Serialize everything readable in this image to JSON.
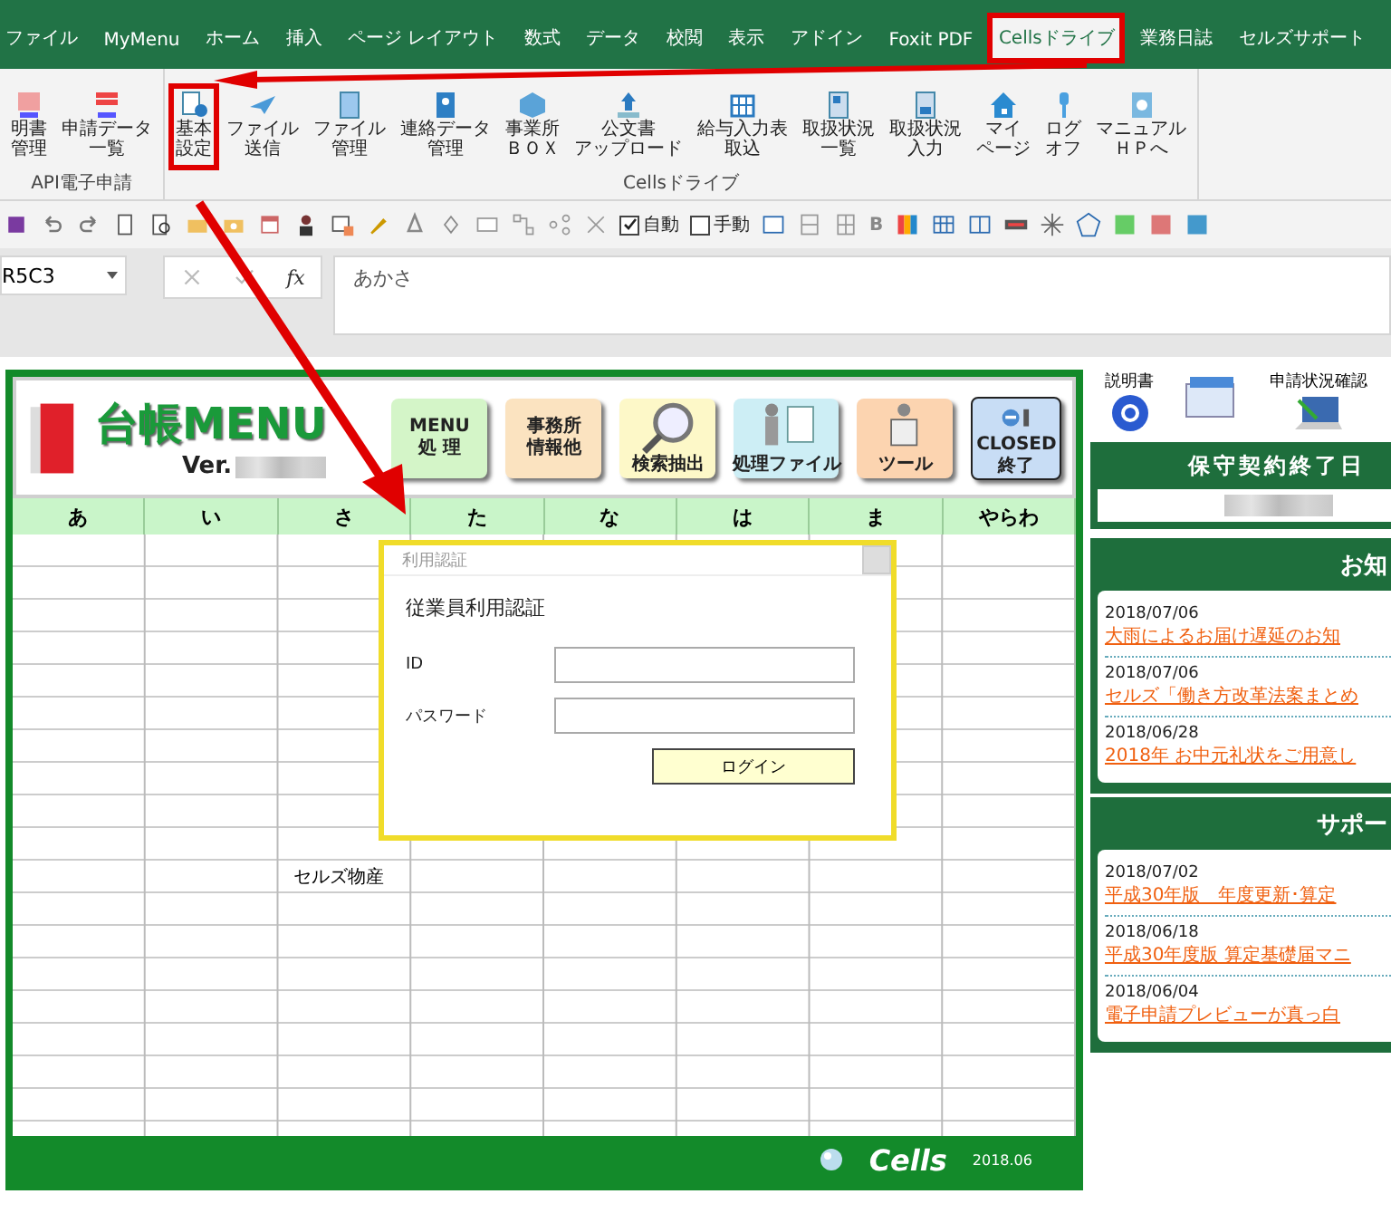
{
  "ribbon_tabs": [
    {
      "label": "ファイル",
      "selected": false
    },
    {
      "label": "MyMenu",
      "selected": false
    },
    {
      "label": "ホーム",
      "selected": false
    },
    {
      "label": "挿入",
      "selected": false
    },
    {
      "label": "ページ レイアウト",
      "selected": false
    },
    {
      "label": "数式",
      "selected": false
    },
    {
      "label": "データ",
      "selected": false
    },
    {
      "label": "校閲",
      "selected": false
    },
    {
      "label": "表示",
      "selected": false
    },
    {
      "label": "アドイン",
      "selected": false
    },
    {
      "label": "Foxit PDF",
      "selected": false
    },
    {
      "label": "Cellsドライブ",
      "selected": true
    },
    {
      "label": "業務日誌",
      "selected": false
    },
    {
      "label": "セルズサポート",
      "selected": false
    }
  ],
  "ribbon_groups": [
    {
      "label": "API電子申請",
      "buttons": [
        {
          "lines": [
            "明書",
            "管理"
          ],
          "highlighted": false
        },
        {
          "lines": [
            "申請データ",
            "一覧"
          ],
          "highlighted": false
        }
      ]
    },
    {
      "label": "Cellsドライブ",
      "buttons": [
        {
          "lines": [
            "基本",
            "設定"
          ],
          "highlighted": true
        },
        {
          "lines": [
            "ファイル",
            "送信"
          ],
          "highlighted": false
        },
        {
          "lines": [
            "ファイル",
            "管理"
          ],
          "highlighted": false
        },
        {
          "lines": [
            "連絡データ",
            "管理"
          ],
          "highlighted": false
        },
        {
          "lines": [
            "事業所",
            "ＢＯＸ"
          ],
          "highlighted": false
        },
        {
          "lines": [
            "公文書",
            "アップロード"
          ],
          "highlighted": false
        },
        {
          "lines": [
            "給与入力表",
            "取込"
          ],
          "highlighted": false
        },
        {
          "lines": [
            "取扱状況",
            "一覧"
          ],
          "highlighted": false
        },
        {
          "lines": [
            "取扱状況",
            "入力"
          ],
          "highlighted": false
        },
        {
          "lines": [
            "マイ",
            "ページ"
          ],
          "highlighted": false
        },
        {
          "lines": [
            "ログ",
            "オフ"
          ],
          "highlighted": false
        },
        {
          "lines": [
            "マニュアル",
            "ＨＰへ"
          ],
          "highlighted": false
        }
      ]
    }
  ],
  "quick_toolbar": {
    "checkboxes": [
      {
        "label": "自動",
        "checked": true
      },
      {
        "label": "手動",
        "checked": false
      }
    ],
    "bold_label": "B"
  },
  "formula_bar": {
    "name_box": "R5C3",
    "function_label": "fx",
    "value": "あかさ"
  },
  "ledger": {
    "title": "台帳MENU",
    "version_label": "Ver.",
    "menu_buttons": [
      {
        "lines": [
          "MENU",
          "処 理"
        ],
        "color": "#d4f5c8"
      },
      {
        "lines": [
          "事務所",
          "情報他"
        ],
        "color": "#fbe3c0"
      },
      {
        "lines": [
          "検索抽出"
        ],
        "color": "#fdf8c8"
      },
      {
        "lines": [
          "処理ファイル"
        ],
        "color": "#cdeef5"
      },
      {
        "lines": [
          "ツール"
        ],
        "color": "#fcd4b0"
      },
      {
        "lines": [
          "CLOSED",
          "終了"
        ],
        "color": "#c8ddf5"
      }
    ],
    "kana_tabs": [
      "あ",
      "い",
      "さ",
      "た",
      "な",
      "は",
      "ま",
      "やらわ"
    ],
    "entries": [
      {
        "text": "セルズ物産"
      }
    ],
    "footer": {
      "brand": "Cells",
      "date": "2018.06"
    }
  },
  "dialog": {
    "title": "利用認証",
    "heading": "従業員利用認証",
    "fields": [
      {
        "label": "ID"
      },
      {
        "label": "パスワード"
      }
    ],
    "button": "ログイン"
  },
  "side_panel": {
    "links": [
      {
        "label": "説明書"
      },
      {
        "label": "申請状況確認"
      }
    ],
    "maintenance": {
      "title": "保守契約終了日"
    },
    "sections": [
      {
        "title": "お知",
        "items": [
          {
            "date": "2018/07/06",
            "text": "大雨によるお届け遅延のお知"
          },
          {
            "date": "2018/07/06",
            "text": "セルズ「働き方改革法案まとめ"
          },
          {
            "date": "2018/06/28",
            "text": "2018年 お中元礼状をご用意し"
          }
        ]
      },
      {
        "title": "サポー",
        "items": [
          {
            "date": "2018/07/02",
            "text": "平成30年版　年度更新･算定"
          },
          {
            "date": "2018/06/18",
            "text": "平成30年度版 算定基礎届マニ"
          },
          {
            "date": "2018/06/04",
            "text": "電子申請プレビューが真っ白"
          }
        ]
      }
    ]
  }
}
